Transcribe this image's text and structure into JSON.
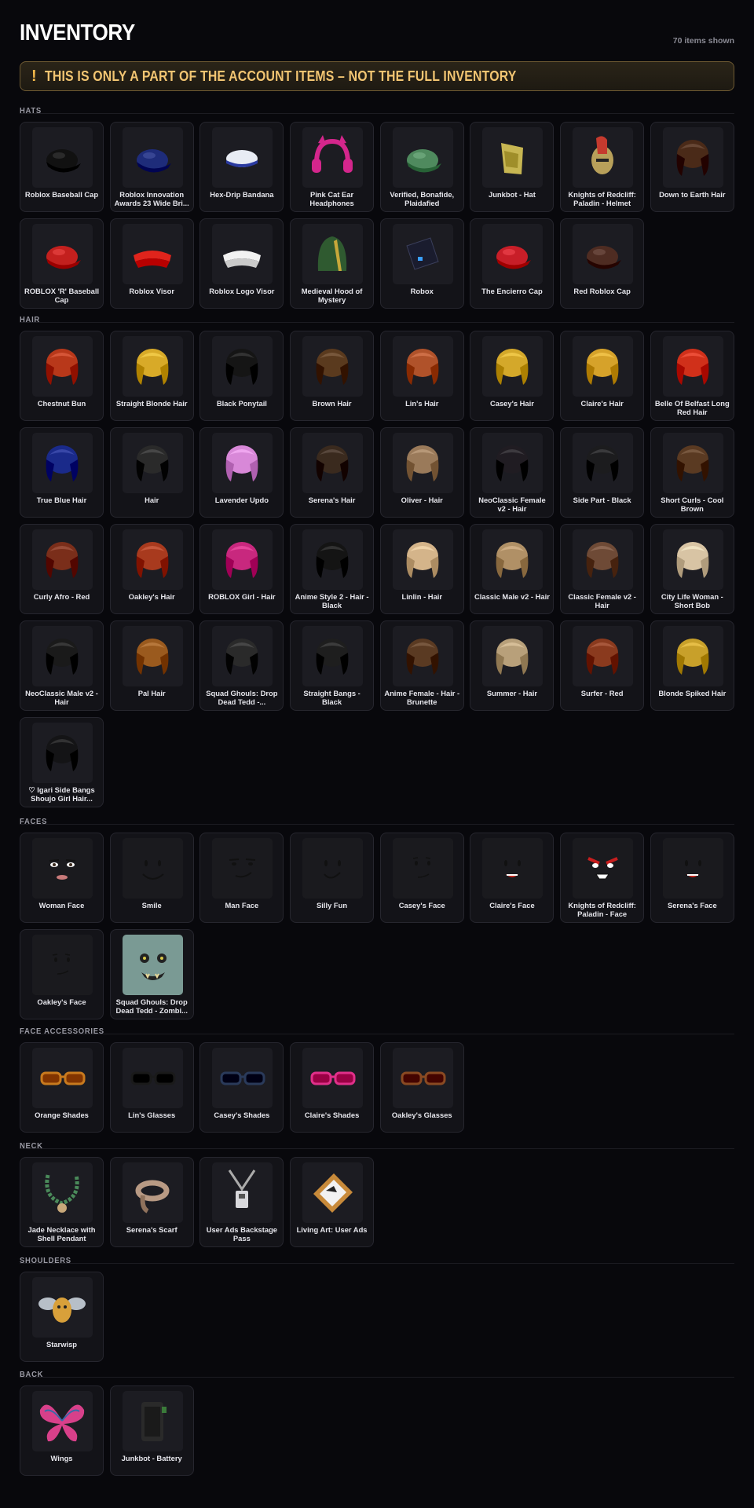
{
  "header": {
    "title": "INVENTORY",
    "count": "70 items shown"
  },
  "banner": {
    "text": "THIS IS ONLY A PART OF THE ACCOUNT ITEMS – NOT THE FULL INVENTORY"
  },
  "sections": [
    {
      "label": "HATS",
      "items": [
        {
          "name": "Roblox Baseball Cap",
          "icon": "cap",
          "color": "#111111"
        },
        {
          "name": "Roblox Innovation Awards 23 Wide Bri...",
          "icon": "cap",
          "color": "#1e2c7a"
        },
        {
          "name": "Hex-Drip Bandana",
          "icon": "bandana",
          "color": "#e8ecf4"
        },
        {
          "name": "Pink Cat Ear Headphones",
          "icon": "headphones",
          "color": "#d4268c"
        },
        {
          "name": "Verified, Bonafide, Plaidafied",
          "icon": "cap",
          "color": "#4f8a5e"
        },
        {
          "name": "Junkbot - Hat",
          "icon": "junkhat",
          "color": "#c7b652"
        },
        {
          "name": "Knights of Redcliff: Paladin - Helmet",
          "icon": "helmet",
          "color": "#c53a2e"
        },
        {
          "name": "Down to Earth Hair",
          "icon": "hair",
          "color": "#4a2a18"
        },
        {
          "name": "ROBLOX 'R' Baseball Cap",
          "icon": "cap",
          "color": "#c3201e"
        },
        {
          "name": "Roblox Visor",
          "icon": "visor",
          "color": "#e0241c"
        },
        {
          "name": "Roblox Logo Visor",
          "icon": "visor",
          "color": "#f2f2f2"
        },
        {
          "name": "Medieval Hood of Mystery",
          "icon": "hood",
          "color": "#2f5a30"
        },
        {
          "name": "Robox",
          "icon": "box",
          "color": "#1a1c2e"
        },
        {
          "name": "The Encierro Cap",
          "icon": "cap",
          "color": "#c81e28"
        },
        {
          "name": "Red Roblox Cap",
          "icon": "cap",
          "color": "#4e2c22"
        }
      ]
    },
    {
      "label": "HAIR",
      "items": [
        {
          "name": "Chestnut Bun",
          "icon": "hair",
          "color": "#b8381a"
        },
        {
          "name": "Straight Blonde Hair",
          "icon": "hair",
          "color": "#d8aa28"
        },
        {
          "name": "Black Ponytail",
          "icon": "hair",
          "color": "#151515"
        },
        {
          "name": "Brown Hair",
          "icon": "hair",
          "color": "#5a3a1e"
        },
        {
          "name": "Lin's Hair",
          "icon": "hair",
          "color": "#b0522a"
        },
        {
          "name": "Casey's Hair",
          "icon": "hair",
          "color": "#d4a82a"
        },
        {
          "name": "Claire's Hair",
          "icon": "hair",
          "color": "#d6a22a"
        },
        {
          "name": "Belle Of Belfast Long Red Hair",
          "icon": "hair",
          "color": "#d0301a"
        },
        {
          "name": "True Blue Hair",
          "icon": "hair",
          "color": "#1a2a8a"
        },
        {
          "name": "Hair",
          "icon": "hair",
          "color": "#2a2a2a"
        },
        {
          "name": "Lavender Updo",
          "icon": "hair",
          "color": "#d888d8"
        },
        {
          "name": "Serena's Hair",
          "icon": "hair",
          "color": "#3a2a1e"
        },
        {
          "name": "Oliver - Hair",
          "icon": "hair",
          "color": "#9a7a5a"
        },
        {
          "name": "NeoClassic Female v2 - Hair",
          "icon": "hair",
          "color": "#201c22"
        },
        {
          "name": "Side Part - Black",
          "icon": "hair",
          "color": "#1c1c1e"
        },
        {
          "name": "Short Curls - Cool Brown",
          "icon": "hair",
          "color": "#5a3a22"
        },
        {
          "name": "Curly Afro - Red",
          "icon": "hair",
          "color": "#7a2e1a"
        },
        {
          "name": "Oakley's Hair",
          "icon": "hair",
          "color": "#a83a1e"
        },
        {
          "name": "ROBLOX Girl - Hair",
          "icon": "hair",
          "color": "#c8287e"
        },
        {
          "name": "Anime Style 2 - Hair - Black",
          "icon": "hair",
          "color": "#141414"
        },
        {
          "name": "Linlin - Hair",
          "icon": "hair",
          "color": "#d4b48a"
        },
        {
          "name": "Classic Male v2 - Hair",
          "icon": "hair",
          "color": "#b09066"
        },
        {
          "name": "Classic Female v2 - Hair",
          "icon": "hair",
          "color": "#6e4a36"
        },
        {
          "name": "City Life Woman - Short Bob",
          "icon": "hair",
          "color": "#d8c4a4"
        },
        {
          "name": "NeoClassic Male v2 - Hair",
          "icon": "hair",
          "color": "#1a1a1a"
        },
        {
          "name": "Pal Hair",
          "icon": "hair",
          "color": "#9a5a1e"
        },
        {
          "name": "Squad Ghouls: Drop Dead Tedd -...",
          "icon": "hair",
          "color": "#2a2a2a"
        },
        {
          "name": "Straight Bangs - Black",
          "icon": "hair",
          "color": "#1e1e1e"
        },
        {
          "name": "Anime Female - Hair - Brunette",
          "icon": "hair",
          "color": "#5a3a22"
        },
        {
          "name": "Summer - Hair",
          "icon": "hair",
          "color": "#b8a07a"
        },
        {
          "name": "Surfer - Red",
          "icon": "hair",
          "color": "#8a3a1e"
        },
        {
          "name": "Blonde Spiked Hair",
          "icon": "hair",
          "color": "#c8a02a"
        },
        {
          "name": "♡ Igari Side Bangs Shoujo Girl Hair...",
          "icon": "hair",
          "color": "#141416"
        }
      ]
    },
    {
      "label": "FACES",
      "items": [
        {
          "name": "Woman Face",
          "icon": "face-woman",
          "color": "#111111"
        },
        {
          "name": "Smile",
          "icon": "face-smile",
          "color": "#111111"
        },
        {
          "name": "Man Face",
          "icon": "face-man",
          "color": "#111111"
        },
        {
          "name": "Silly Fun",
          "icon": "face-silly",
          "color": "#111111"
        },
        {
          "name": "Casey's Face",
          "icon": "face-casey",
          "color": "#111111"
        },
        {
          "name": "Claire's Face",
          "icon": "face-claire",
          "color": "#111111"
        },
        {
          "name": "Knights of Redcliff: Paladin - Face",
          "icon": "face-paladin",
          "color": "#111111"
        },
        {
          "name": "Serena's Face",
          "icon": "face-claire",
          "color": "#111111"
        },
        {
          "name": "Oakley's Face",
          "icon": "face-casey",
          "color": "#111111"
        },
        {
          "name": "Squad Ghouls: Drop Dead Tedd - Zombi...",
          "icon": "face-zombie",
          "color": "#7a9a94"
        }
      ]
    },
    {
      "label": "FACE ACCESSORIES",
      "items": [
        {
          "name": "Orange Shades",
          "icon": "glasses",
          "color": "#c87a1e"
        },
        {
          "name": "Lin's Glasses",
          "icon": "glasses",
          "color": "#1a1a1a"
        },
        {
          "name": "Casey's Shades",
          "icon": "glasses",
          "color": "#2a3a5a"
        },
        {
          "name": "Claire's Shades",
          "icon": "glasses",
          "color": "#e0308a"
        },
        {
          "name": "Oakley's Glasses",
          "icon": "glasses",
          "color": "#8a4a22"
        }
      ]
    },
    {
      "label": "NECK",
      "items": [
        {
          "name": "Jade Necklace with Shell Pendant",
          "icon": "necklace",
          "color": "#4a8a5a"
        },
        {
          "name": "Serena's Scarf",
          "icon": "scarf",
          "color": "#b89a84"
        },
        {
          "name": "User Ads Backstage Pass",
          "icon": "pass",
          "color": "#d8d8dc"
        },
        {
          "name": "Living Art: User Ads",
          "icon": "frame",
          "color": "#c88a3a"
        }
      ]
    },
    {
      "label": "SHOULDERS",
      "items": [
        {
          "name": "Starwisp",
          "icon": "bee",
          "color": "#d8a03a"
        }
      ]
    },
    {
      "label": "BACK",
      "items": [
        {
          "name": "Wings",
          "icon": "wings",
          "color": "#d8408a"
        },
        {
          "name": "Junkbot - Battery",
          "icon": "battery",
          "color": "#2a2a2a"
        }
      ]
    }
  ]
}
